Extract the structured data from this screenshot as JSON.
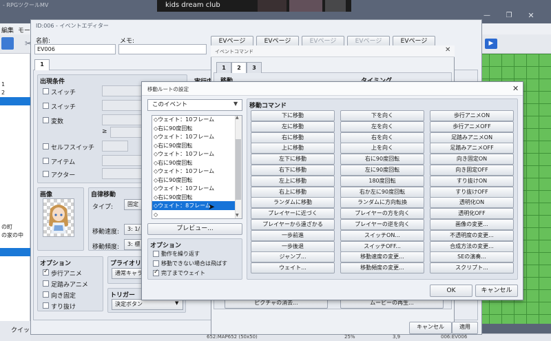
{
  "main": {
    "app_title": "- RPGツクールMV",
    "caption": "kids dream club",
    "menu": [
      "編集",
      "モード"
    ],
    "maps": [
      {
        "label": "1"
      },
      {
        "label": "2"
      }
    ],
    "maps_lower": [
      {
        "label": "の町"
      },
      {
        "label": "の家の中"
      }
    ],
    "quick_tab": "クイック",
    "status": [
      "652:MAP652 (50x50)",
      "25%",
      "3,9",
      "006:EV006"
    ]
  },
  "event_editor": {
    "title": "ID:006 - イベントエディター",
    "name_label": "名前:",
    "name_value": "EV006",
    "memo_label": "メモ:",
    "page_buttons": [
      "EVページ",
      "EVページ",
      "EVページ",
      "EVページ",
      "EVページ"
    ],
    "page_tab": "1",
    "conditions_title": "出現条件",
    "conditions": [
      "スイッチ",
      "スイッチ",
      "変数",
      "セルフスイッチ",
      "アイテム",
      "アクター"
    ],
    "ge_symbol": "≥",
    "exec_title": "実行内",
    "image_title": "画像",
    "autonomous_title": "自律移動",
    "type_label": "タイプ:",
    "type_value": "固定",
    "speed_label": "移動速度:",
    "speed_value": "3: 1/",
    "freq_label": "移動頻度:",
    "freq_value": "3: 標",
    "options_title": "オプション",
    "options": [
      {
        "label": "歩行アニメ",
        "checked": true
      },
      {
        "label": "足踏みアニメ",
        "checked": false
      },
      {
        "label": "向き固定",
        "checked": false
      },
      {
        "label": "すり抜け",
        "checked": false
      }
    ],
    "priority_title": "プライオリテ",
    "priority_value": "通常キャラ",
    "trigger_title": "トリガー",
    "trigger_value": "決定ボタン",
    "cancel": "キャンセル",
    "apply": "適用"
  },
  "event_command": {
    "title": "イベントコマンド",
    "tabs": [
      "1",
      "2",
      "3"
    ],
    "header_left": "移動",
    "header_right": "タイミング",
    "picture_erase": "ピクチャの消去...",
    "movie_play": "ムービーの再生..."
  },
  "move_route": {
    "title": "移動ルートの設定",
    "target": "このイベント",
    "route_items": [
      "◇ウェイト：10フレーム",
      "◇右に90度回転",
      "◇ウェイト：10フレーム",
      "◇右に90度回転",
      "◇ウェイト：10フレーム",
      "◇右に90度回転",
      "◇ウェイト：10フレーム",
      "◇右に90度回転",
      "◇ウェイト：10フレーム",
      "◇右に90度回転",
      "◇ウェイト：8フレーム",
      "◇"
    ],
    "selected_index": 10,
    "preview": "プレビュー...",
    "options_title": "オプション",
    "options": [
      {
        "label": "動作を繰り返す",
        "checked": false
      },
      {
        "label": "移動できない場合は飛ばす",
        "checked": false
      },
      {
        "label": "完了までウェイト",
        "checked": true
      }
    ],
    "commands_title": "移動コマンド",
    "commands": [
      [
        "下に移動",
        "下を向く",
        "歩行アニメON"
      ],
      [
        "左に移動",
        "左を向く",
        "歩行アニメOFF"
      ],
      [
        "右に移動",
        "右を向く",
        "足踏みアニメON"
      ],
      [
        "上に移動",
        "上を向く",
        "足踏みアニメOFF"
      ],
      [
        "左下に移動",
        "右に90度回転",
        "向き固定ON"
      ],
      [
        "右下に移動",
        "左に90度回転",
        "向き固定OFF"
      ],
      [
        "左上に移動",
        "180度回転",
        "すり抜けON"
      ],
      [
        "右上に移動",
        "右か左に90度回転",
        "すり抜けOFF"
      ],
      [
        "ランダムに移動",
        "ランダムに方向転換",
        "透明化ON"
      ],
      [
        "プレイヤーに近づく",
        "プレイヤーの方を向く",
        "透明化OFF"
      ],
      [
        "プレイヤーから遠ざかる",
        "プレイヤーの逆を向く",
        "画像の変更..."
      ],
      [
        "一歩前進",
        "スイッチON...",
        "不透明度の変更..."
      ],
      [
        "一歩後退",
        "スイッチOFF...",
        "合成方法の変更..."
      ],
      [
        "ジャンプ...",
        "移動速度の変更...",
        "SEの演奏..."
      ],
      [
        "ウェイト...",
        "移動頻度の変更...",
        "スクリプト..."
      ]
    ],
    "ok": "OK",
    "cancel": "キャンセル"
  }
}
